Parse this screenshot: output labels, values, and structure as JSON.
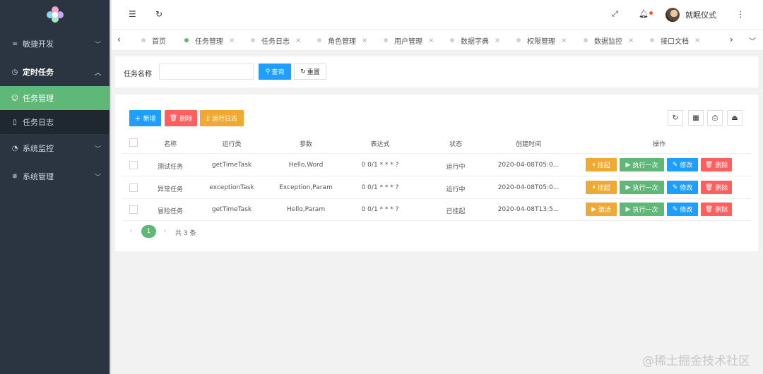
{
  "sidebar": {
    "items": [
      {
        "label": "敏捷开发",
        "icon": "infinity-icon"
      },
      {
        "label": "定时任务",
        "icon": "clock-icon"
      },
      {
        "label": "系统监控",
        "icon": "gauge-icon"
      },
      {
        "label": "系统管理",
        "icon": "gear-icon"
      }
    ],
    "sub_items": [
      {
        "label": "任务管理",
        "icon": "smile-icon"
      },
      {
        "label": "任务日志",
        "icon": "file-icon"
      }
    ]
  },
  "header": {
    "user_name": "就眠仪式"
  },
  "tabs": [
    {
      "label": "首页"
    },
    {
      "label": "任务管理"
    },
    {
      "label": "任务日志"
    },
    {
      "label": "角色管理"
    },
    {
      "label": "用户管理"
    },
    {
      "label": "数据字典"
    },
    {
      "label": "权限管理"
    },
    {
      "label": "数据监控"
    },
    {
      "label": "接口文档"
    }
  ],
  "search": {
    "label": "任务名称",
    "value": "",
    "query_button": "查询",
    "reset_button": "重置"
  },
  "toolbar": {
    "add_button": "新增",
    "delete_button": "删除",
    "log_button": "运行日志"
  },
  "table": {
    "columns": [
      "名称",
      "运行类",
      "参数",
      "表达式",
      "状态",
      "创建时间",
      "操作"
    ],
    "rows": [
      {
        "name": "测试任务",
        "run_class": "getTimeTask",
        "params": "Hello,Word",
        "cron": "0 0/1 * * * ?",
        "status": "运行中",
        "created": "2020-04-08T05:0...",
        "toggle": "挂起",
        "run_once": "执行一次",
        "edit": "修改",
        "delete": "删除"
      },
      {
        "name": "异常任务",
        "run_class": "exceptionTask",
        "params": "Exception,Param",
        "cron": "0 0/1 * * * ?",
        "status": "运行中",
        "created": "2020-04-08T05:0...",
        "toggle": "挂起",
        "run_once": "执行一次",
        "edit": "修改",
        "delete": "删除"
      },
      {
        "name": "冒险任务",
        "run_class": "getTimeTask",
        "params": "Hello,Param",
        "cron": "0 0/1 * * * ?",
        "status": "已挂起",
        "created": "2020-04-08T13:5...",
        "toggle": "激活",
        "run_once": "执行一次",
        "edit": "修改",
        "delete": "删除"
      }
    ]
  },
  "pagination": {
    "current": "1",
    "total_text": "共 3 条"
  },
  "watermark": "@稀土掘金技术社区",
  "colors": {
    "sidebar_bg": "#2b3542",
    "active_green": "#5fb878",
    "blue": "#1e9fff",
    "red": "#ff5f5f",
    "orange": "#f0a932"
  }
}
